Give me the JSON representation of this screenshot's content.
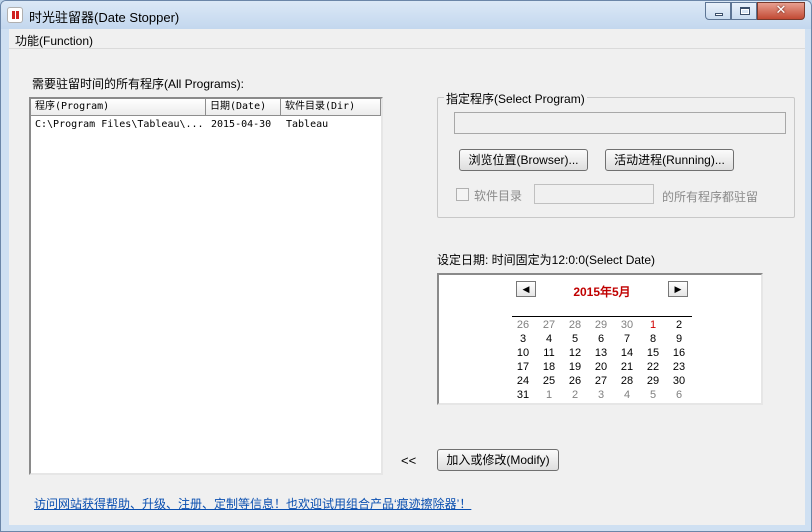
{
  "window": {
    "title": "时光驻留器(Date Stopper)"
  },
  "menu": {
    "items": [
      "功能(Function)"
    ]
  },
  "program_list": {
    "label": "需要驻留时间的所有程序(All Programs):",
    "columns": [
      "程序(Program)",
      "日期(Date)",
      "软件目录(Dir)"
    ],
    "rows": [
      [
        "C:\\Program Files\\Tableau\\...",
        "2015-04-30",
        "Tableau"
      ]
    ]
  },
  "select_program": {
    "legend": "指定程序(Select Program)",
    "path_value": "",
    "browse_label": "浏览位置(Browser)...",
    "running_label": "活动进程(Running)...",
    "dir_checkbox_label": "软件目录",
    "dir_value": "",
    "dir_suffix": "的所有程序都驻留"
  },
  "date": {
    "label": "设定日期: 时间固定为12:0:0(Select Date)",
    "month_label": "2015年5月",
    "prev_glyph": "◀",
    "next_glyph": "▶",
    "selected_day": 1,
    "weeks": [
      [
        {
          "d": "26",
          "o": true
        },
        {
          "d": "27",
          "o": true
        },
        {
          "d": "28",
          "o": true
        },
        {
          "d": "29",
          "o": true
        },
        {
          "d": "30",
          "o": true
        },
        {
          "d": "1",
          "t": true
        },
        {
          "d": "2"
        }
      ],
      [
        {
          "d": "3"
        },
        {
          "d": "4"
        },
        {
          "d": "5"
        },
        {
          "d": "6"
        },
        {
          "d": "7"
        },
        {
          "d": "8"
        },
        {
          "d": "9"
        }
      ],
      [
        {
          "d": "10"
        },
        {
          "d": "11"
        },
        {
          "d": "12"
        },
        {
          "d": "13"
        },
        {
          "d": "14"
        },
        {
          "d": "15"
        },
        {
          "d": "16"
        }
      ],
      [
        {
          "d": "17"
        },
        {
          "d": "18"
        },
        {
          "d": "19"
        },
        {
          "d": "20"
        },
        {
          "d": "21"
        },
        {
          "d": "22"
        },
        {
          "d": "23"
        }
      ],
      [
        {
          "d": "24"
        },
        {
          "d": "25"
        },
        {
          "d": "26"
        },
        {
          "d": "27"
        },
        {
          "d": "28"
        },
        {
          "d": "29"
        },
        {
          "d": "30"
        }
      ],
      [
        {
          "d": "31"
        },
        {
          "d": "1",
          "o": true
        },
        {
          "d": "2",
          "o": true
        },
        {
          "d": "3",
          "o": true
        },
        {
          "d": "4",
          "o": true
        },
        {
          "d": "5",
          "o": true
        },
        {
          "d": "6",
          "o": true
        }
      ]
    ]
  },
  "actions": {
    "arrow_label": "<<",
    "modify_label": "加入或修改(Modify)"
  },
  "footer": {
    "link_text": "访问网站获得帮助、升级、注册、定制等信息！也欢迎试用组合产品‘痕迹擦除器’！"
  },
  "colors": {
    "accent_red": "#c00000",
    "link_blue": "#0a4fb0",
    "titlebar": "#c3d7ee"
  }
}
